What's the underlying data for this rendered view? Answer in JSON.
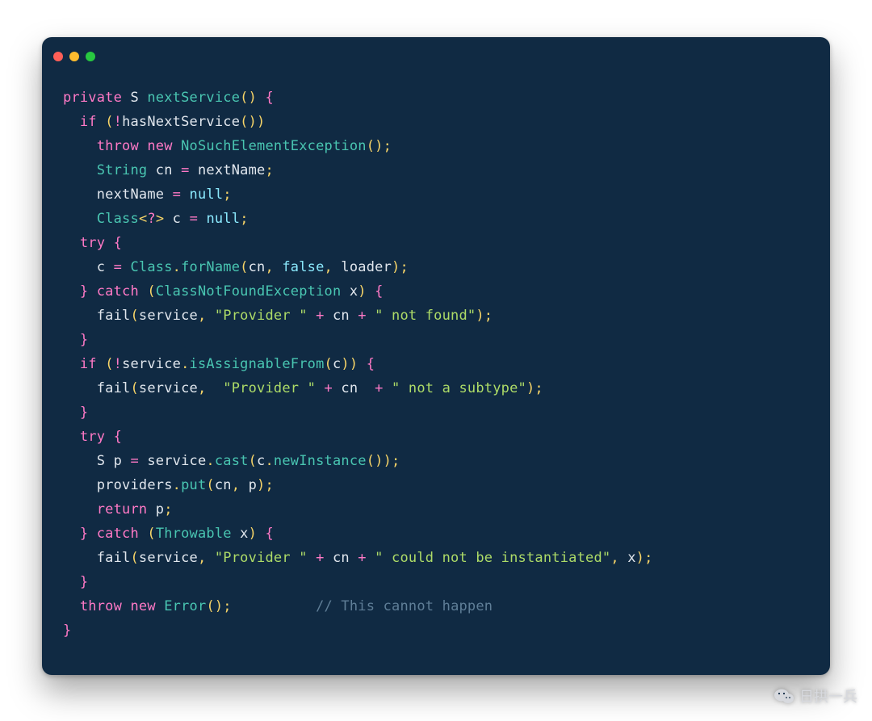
{
  "colors": {
    "window_bg": "#102a43",
    "dot_red": "#ff5f57",
    "dot_yellow": "#febc2e",
    "dot_green": "#28c840",
    "keyword": "#ff79c6",
    "type": "#49c5b1",
    "identifier": "#e0e6ed",
    "literal": "#8be9fd",
    "string": "#addb67",
    "punct": "#f8d568",
    "comment": "#5f7e97"
  },
  "watermark_text": "日拱一兵",
  "code_lines": [
    [
      [
        "k",
        "private"
      ],
      [
        "id",
        " S "
      ],
      [
        "mn",
        "nextService"
      ],
      [
        "pun",
        "()"
      ],
      [
        "id",
        " "
      ],
      [
        "br",
        "{"
      ]
    ],
    [
      [
        "id",
        "  "
      ],
      [
        "k",
        "if"
      ],
      [
        "id",
        " "
      ],
      [
        "pun",
        "("
      ],
      [
        "op",
        "!"
      ],
      [
        "id",
        "hasNextService"
      ],
      [
        "pun",
        "())"
      ]
    ],
    [
      [
        "id",
        "    "
      ],
      [
        "k",
        "throw"
      ],
      [
        "id",
        " "
      ],
      [
        "k",
        "new"
      ],
      [
        "id",
        " "
      ],
      [
        "ty",
        "NoSuchElementException"
      ],
      [
        "pun",
        "();"
      ]
    ],
    [
      [
        "id",
        "    "
      ],
      [
        "ty",
        "String"
      ],
      [
        "id",
        " cn "
      ],
      [
        "op",
        "="
      ],
      [
        "id",
        " nextName"
      ],
      [
        "pun",
        ";"
      ]
    ],
    [
      [
        "id",
        "    nextName "
      ],
      [
        "op",
        "="
      ],
      [
        "id",
        " "
      ],
      [
        "lit",
        "null"
      ],
      [
        "pun",
        ";"
      ]
    ],
    [
      [
        "id",
        "    "
      ],
      [
        "ty",
        "Class"
      ],
      [
        "pun",
        "<"
      ],
      [
        "op",
        "?"
      ],
      [
        "pun",
        ">"
      ],
      [
        "id",
        " c "
      ],
      [
        "op",
        "="
      ],
      [
        "id",
        " "
      ],
      [
        "lit",
        "null"
      ],
      [
        "pun",
        ";"
      ]
    ],
    [
      [
        "id",
        "  "
      ],
      [
        "k",
        "try"
      ],
      [
        "id",
        " "
      ],
      [
        "br",
        "{"
      ]
    ],
    [
      [
        "id",
        "    c "
      ],
      [
        "op",
        "="
      ],
      [
        "id",
        " "
      ],
      [
        "ty",
        "Class"
      ],
      [
        "pun",
        "."
      ],
      [
        "mn",
        "forName"
      ],
      [
        "pun",
        "("
      ],
      [
        "id",
        "cn"
      ],
      [
        "pun",
        ","
      ],
      [
        "id",
        " "
      ],
      [
        "lit",
        "false"
      ],
      [
        "pun",
        ","
      ],
      [
        "id",
        " loader"
      ],
      [
        "pun",
        ");"
      ]
    ],
    [
      [
        "id",
        "  "
      ],
      [
        "br",
        "}"
      ],
      [
        "id",
        " "
      ],
      [
        "k",
        "catch"
      ],
      [
        "id",
        " "
      ],
      [
        "pun",
        "("
      ],
      [
        "ty",
        "ClassNotFoundException"
      ],
      [
        "id",
        " x"
      ],
      [
        "pun",
        ")"
      ],
      [
        "id",
        " "
      ],
      [
        "br",
        "{"
      ]
    ],
    [
      [
        "id",
        "    fail"
      ],
      [
        "pun",
        "("
      ],
      [
        "id",
        "service"
      ],
      [
        "pun",
        ","
      ],
      [
        "id",
        " "
      ],
      [
        "str",
        "\"Provider \""
      ],
      [
        "id",
        " "
      ],
      [
        "op",
        "+"
      ],
      [
        "id",
        " cn "
      ],
      [
        "op",
        "+"
      ],
      [
        "id",
        " "
      ],
      [
        "str",
        "\" not found\""
      ],
      [
        "pun",
        ");"
      ]
    ],
    [
      [
        "id",
        "  "
      ],
      [
        "br",
        "}"
      ]
    ],
    [
      [
        "id",
        "  "
      ],
      [
        "k",
        "if"
      ],
      [
        "id",
        " "
      ],
      [
        "pun",
        "("
      ],
      [
        "op",
        "!"
      ],
      [
        "id",
        "service"
      ],
      [
        "pun",
        "."
      ],
      [
        "mn",
        "isAssignableFrom"
      ],
      [
        "pun",
        "("
      ],
      [
        "id",
        "c"
      ],
      [
        "pun",
        "))"
      ],
      [
        "id",
        " "
      ],
      [
        "br",
        "{"
      ]
    ],
    [
      [
        "id",
        "    fail"
      ],
      [
        "pun",
        "("
      ],
      [
        "id",
        "service"
      ],
      [
        "pun",
        ","
      ],
      [
        "id",
        "  "
      ],
      [
        "str",
        "\"Provider \""
      ],
      [
        "id",
        " "
      ],
      [
        "op",
        "+"
      ],
      [
        "id",
        " cn  "
      ],
      [
        "op",
        "+"
      ],
      [
        "id",
        " "
      ],
      [
        "str",
        "\" not a subtype\""
      ],
      [
        "pun",
        ");"
      ]
    ],
    [
      [
        "id",
        "  "
      ],
      [
        "br",
        "}"
      ]
    ],
    [
      [
        "id",
        "  "
      ],
      [
        "k",
        "try"
      ],
      [
        "id",
        " "
      ],
      [
        "br",
        "{"
      ]
    ],
    [
      [
        "id",
        "    S p "
      ],
      [
        "op",
        "="
      ],
      [
        "id",
        " service"
      ],
      [
        "pun",
        "."
      ],
      [
        "mn",
        "cast"
      ],
      [
        "pun",
        "("
      ],
      [
        "id",
        "c"
      ],
      [
        "pun",
        "."
      ],
      [
        "mn",
        "newInstance"
      ],
      [
        "pun",
        "());"
      ]
    ],
    [
      [
        "id",
        "    providers"
      ],
      [
        "pun",
        "."
      ],
      [
        "mn",
        "put"
      ],
      [
        "pun",
        "("
      ],
      [
        "id",
        "cn"
      ],
      [
        "pun",
        ","
      ],
      [
        "id",
        " p"
      ],
      [
        "pun",
        ");"
      ]
    ],
    [
      [
        "id",
        "    "
      ],
      [
        "k",
        "return"
      ],
      [
        "id",
        " p"
      ],
      [
        "pun",
        ";"
      ]
    ],
    [
      [
        "id",
        "  "
      ],
      [
        "br",
        "}"
      ],
      [
        "id",
        " "
      ],
      [
        "k",
        "catch"
      ],
      [
        "id",
        " "
      ],
      [
        "pun",
        "("
      ],
      [
        "ty",
        "Throwable"
      ],
      [
        "id",
        " x"
      ],
      [
        "pun",
        ")"
      ],
      [
        "id",
        " "
      ],
      [
        "br",
        "{"
      ]
    ],
    [
      [
        "id",
        "    fail"
      ],
      [
        "pun",
        "("
      ],
      [
        "id",
        "service"
      ],
      [
        "pun",
        ","
      ],
      [
        "id",
        " "
      ],
      [
        "str",
        "\"Provider \""
      ],
      [
        "id",
        " "
      ],
      [
        "op",
        "+"
      ],
      [
        "id",
        " cn "
      ],
      [
        "op",
        "+"
      ],
      [
        "id",
        " "
      ],
      [
        "str",
        "\" could not be instantiated\""
      ],
      [
        "pun",
        ","
      ],
      [
        "id",
        " x"
      ],
      [
        "pun",
        ");"
      ]
    ],
    [
      [
        "id",
        "  "
      ],
      [
        "br",
        "}"
      ]
    ],
    [
      [
        "id",
        "  "
      ],
      [
        "k",
        "throw"
      ],
      [
        "id",
        " "
      ],
      [
        "k",
        "new"
      ],
      [
        "id",
        " "
      ],
      [
        "ty",
        "Error"
      ],
      [
        "pun",
        "();"
      ],
      [
        "id",
        "          "
      ],
      [
        "cmt",
        "// This cannot happen"
      ]
    ],
    [
      [
        "br",
        "}"
      ]
    ]
  ]
}
